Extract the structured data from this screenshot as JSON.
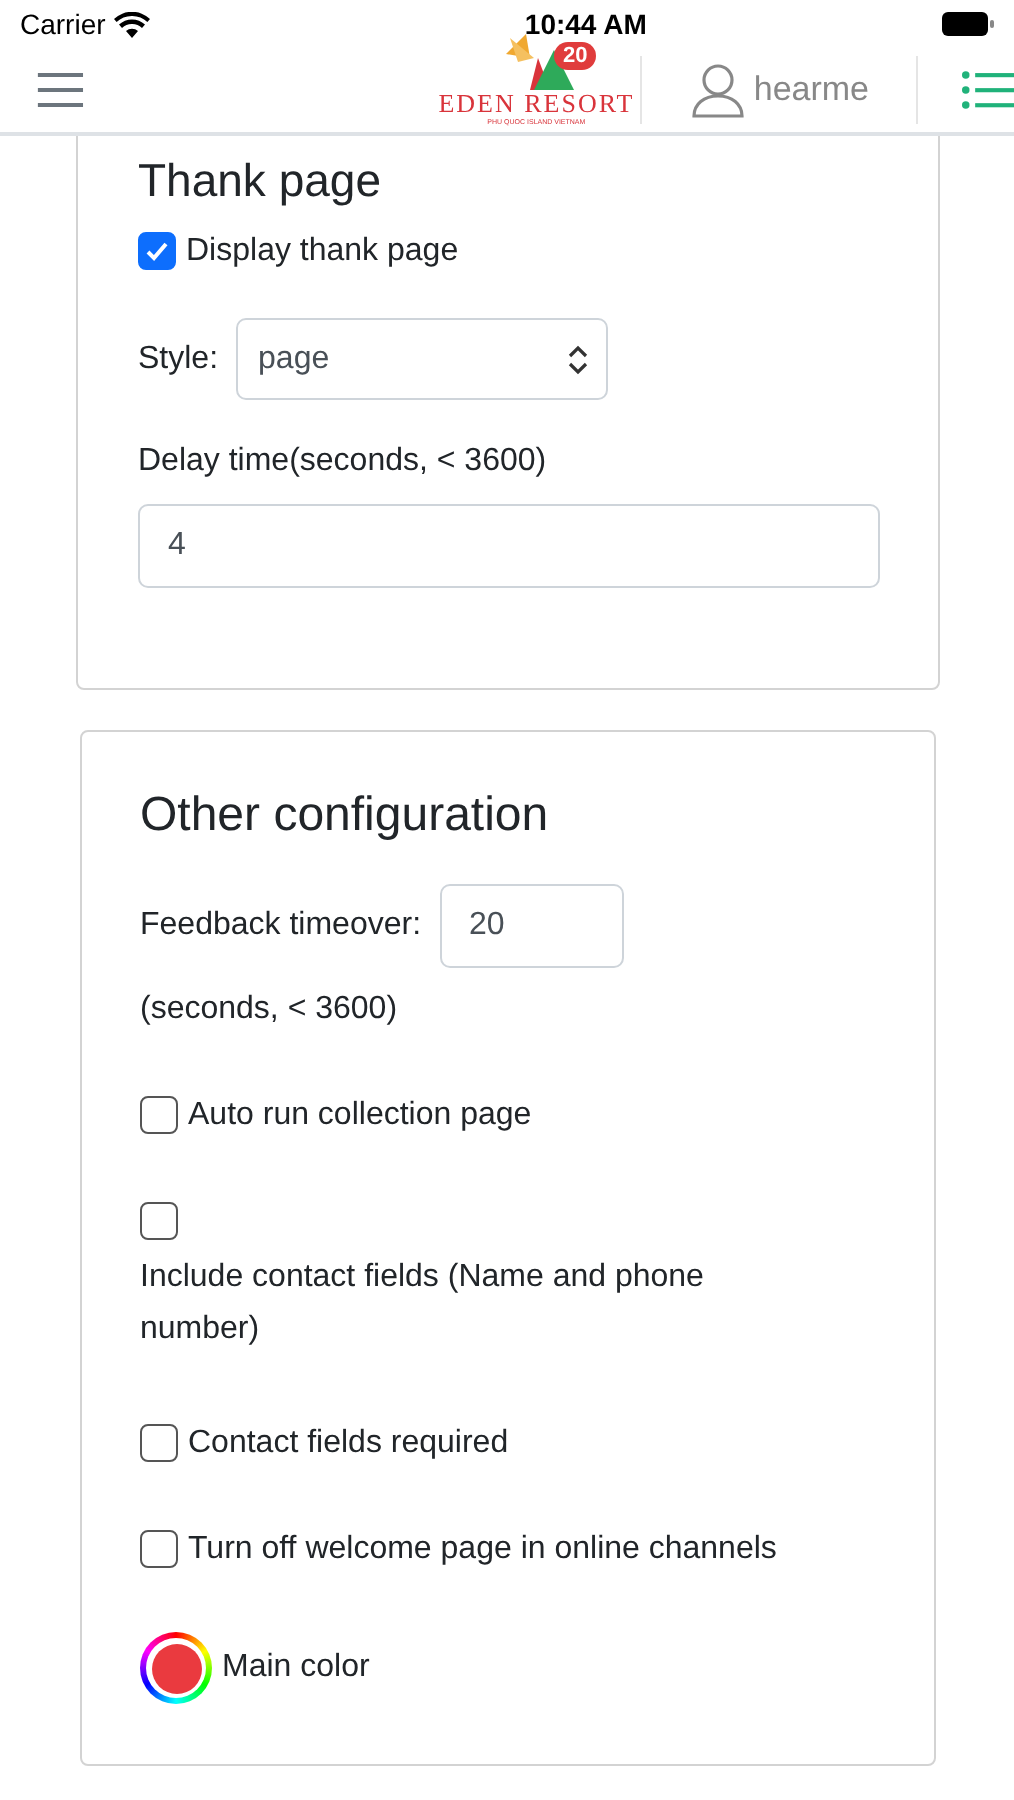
{
  "status_bar": {
    "carrier": "Carrier",
    "time": "10:44 AM"
  },
  "header": {
    "logo": {
      "name": "EDEN RESORT",
      "tagline": "PHU QUOC ISLAND VIETNAM",
      "badge": "20"
    },
    "user": "hearme"
  },
  "thank_page": {
    "title": "Thank page",
    "display": {
      "label": "Display thank page",
      "checked": true
    },
    "style": {
      "label": "Style:",
      "value": "page"
    },
    "delay": {
      "label": "Delay time(seconds, < 3600)",
      "value": "4"
    }
  },
  "other_configuration": {
    "title": "Other configuration",
    "feedback_timeover": {
      "label": "Feedback timeover:",
      "value": "20",
      "note": "(seconds, < 3600)"
    },
    "options": [
      {
        "label": "Auto run collection page",
        "checked": false,
        "kind": "inline"
      },
      {
        "label": "Include contact fields (Name and phone number)",
        "checked": false,
        "kind": "stacked"
      },
      {
        "label": "Contact fields required",
        "checked": false,
        "kind": "inline"
      },
      {
        "label": "Turn off welcome page in online channels",
        "checked": false,
        "kind": "inline"
      }
    ],
    "main_color": {
      "label": "Main color",
      "color": "#ea3a3f"
    }
  }
}
